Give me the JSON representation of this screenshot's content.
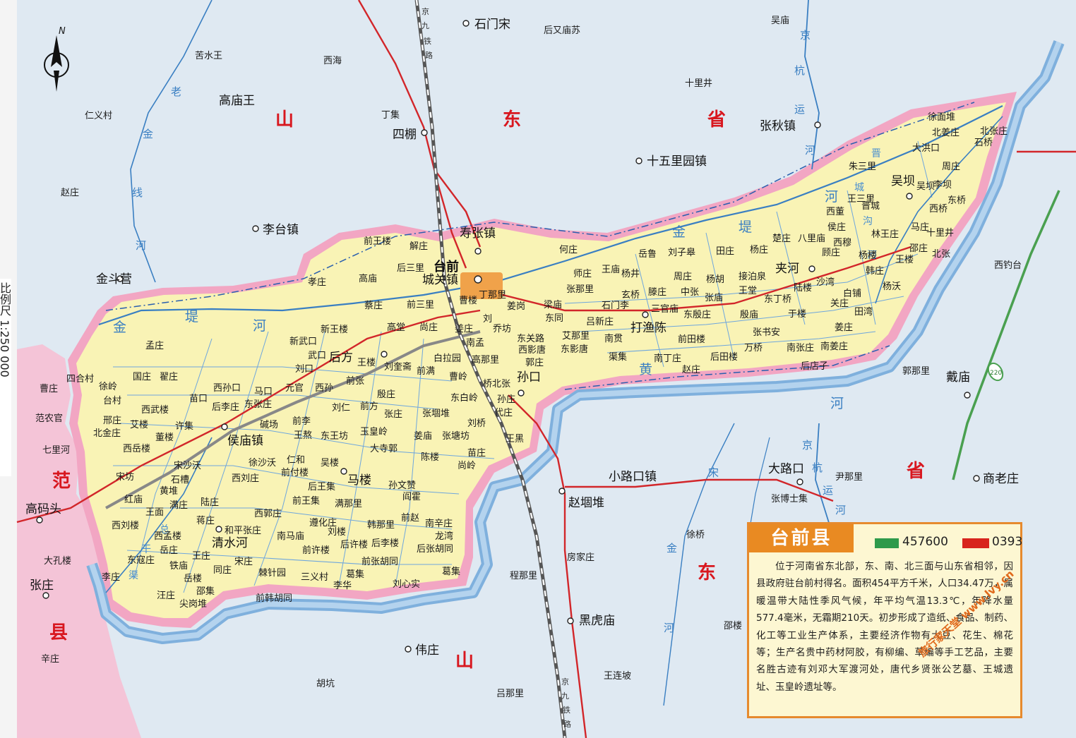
{
  "county": {
    "title": "台前县",
    "postal_code": "457600",
    "area_code": "0393",
    "description": "位于河南省东北部，东、南、北三面与山东省相邻，因县政府驻台前村得名。面积454平方千米，人口34.47万，属暖温带大陆性季风气候，年平均气温13.3℃，年降水量577.4毫米，无霜期210天。初步形成了造纸、食品、制药、化工等工业生产体系，主要经济作物有大豆、花生、棉花等；生产名贵中药材阿胶，有柳编、草编等手工艺品，主要名胜古迹有刘邓大军渡河处，唐代乡贤张公艺墓、王城遗址、玉皇岭遗址等。"
  },
  "compass": {
    "north": "N"
  },
  "side_label": "比例尺 1:250 000",
  "watermark": "旅行家天堂 www.lvy.cn",
  "colors": {
    "county_fill": "#f9f3b5",
    "border_pink": "#f2a6c3",
    "river": "#3a7fc2",
    "road_red": "#d2262a",
    "outside": "#dfe9f2"
  },
  "provinces": [
    {
      "id": "p1",
      "text": "山"
    },
    {
      "id": "p2",
      "text": "东"
    },
    {
      "id": "p3",
      "text": "省"
    },
    {
      "id": "p4",
      "text": "山"
    },
    {
      "id": "p5",
      "text": "东"
    },
    {
      "id": "p6",
      "text": "省"
    },
    {
      "id": "p7",
      "text": "范"
    },
    {
      "id": "p8",
      "text": "县"
    }
  ],
  "rivers": [
    {
      "id": "r1",
      "text": "黄"
    },
    {
      "id": "r2",
      "text": "河"
    },
    {
      "id": "r3",
      "text": "金"
    },
    {
      "id": "r4",
      "text": "堤"
    },
    {
      "id": "r5",
      "text": "河"
    },
    {
      "id": "r6",
      "text": "金"
    },
    {
      "id": "r7",
      "text": "堤"
    },
    {
      "id": "r8",
      "text": "河"
    },
    {
      "id": "r9",
      "text": "老"
    },
    {
      "id": "r10",
      "text": "金"
    },
    {
      "id": "r11",
      "text": "线"
    },
    {
      "id": "r12",
      "text": "河"
    },
    {
      "id": "r13",
      "text": "京"
    },
    {
      "id": "r14",
      "text": "杭"
    },
    {
      "id": "r15",
      "text": "运"
    },
    {
      "id": "r16",
      "text": "河"
    },
    {
      "id": "r17",
      "text": "京"
    },
    {
      "id": "r18",
      "text": "杭"
    },
    {
      "id": "r19",
      "text": "运"
    },
    {
      "id": "r20",
      "text": "河"
    },
    {
      "id": "r21",
      "text": "宋"
    },
    {
      "id": "r22",
      "text": "金"
    },
    {
      "id": "r23",
      "text": "河"
    },
    {
      "id": "r24",
      "text": "晋"
    },
    {
      "id": "r25",
      "text": "城"
    },
    {
      "id": "r26",
      "text": "沟"
    },
    {
      "id": "r27",
      "text": "河"
    },
    {
      "id": "r28",
      "text": "总"
    },
    {
      "id": "r29",
      "text": "干"
    },
    {
      "id": "r30",
      "text": "渠"
    }
  ],
  "railways": [
    {
      "id": "rw1",
      "text": "京"
    },
    {
      "id": "rw2",
      "text": "九"
    },
    {
      "id": "rw3",
      "text": "铁"
    },
    {
      "id": "rw4",
      "text": "路"
    },
    {
      "id": "rw5",
      "text": "京"
    },
    {
      "id": "rw6",
      "text": "九"
    },
    {
      "id": "rw7",
      "text": "铁"
    },
    {
      "id": "rw8",
      "text": "路"
    }
  ],
  "highway_shield": "220",
  "towns": [
    {
      "id": "t1",
      "text": "台前"
    },
    {
      "id": "t2",
      "text": "城关镇"
    },
    {
      "id": "t3",
      "text": "寿张镇"
    },
    {
      "id": "t4",
      "text": "打渔陈"
    },
    {
      "id": "t5",
      "text": "孙口"
    },
    {
      "id": "t6",
      "text": "后方"
    },
    {
      "id": "t7",
      "text": "侯庙镇"
    },
    {
      "id": "t8",
      "text": "马楼"
    },
    {
      "id": "t9",
      "text": "清水河"
    },
    {
      "id": "t10",
      "text": "夹河"
    },
    {
      "id": "t11",
      "text": "吴坝"
    }
  ],
  "external_towns": [
    {
      "id": "e1",
      "text": "石门宋"
    },
    {
      "id": "e2",
      "text": "高庙王"
    },
    {
      "id": "e3",
      "text": "四棚"
    },
    {
      "id": "e4",
      "text": "张秋镇"
    },
    {
      "id": "e5",
      "text": "十五里园镇"
    },
    {
      "id": "e6",
      "text": "李台镇"
    },
    {
      "id": "e7",
      "text": "金斗营"
    },
    {
      "id": "e8",
      "text": "小路口镇"
    },
    {
      "id": "e9",
      "text": "赵堌堆"
    },
    {
      "id": "e10",
      "text": "大路口"
    },
    {
      "id": "e11",
      "text": "黑虎庙"
    },
    {
      "id": "e12",
      "text": "伟庄"
    },
    {
      "id": "e13",
      "text": "高码头"
    },
    {
      "id": "e14",
      "text": "张庄"
    },
    {
      "id": "e15",
      "text": "戴庙"
    },
    {
      "id": "e16",
      "text": "商老庄"
    }
  ],
  "villages": [
    {
      "id": "v1",
      "text": "吴庙"
    },
    {
      "id": "v2",
      "text": "后又庙苏"
    },
    {
      "id": "v3",
      "text": "苦水王"
    },
    {
      "id": "v4",
      "text": "西海"
    },
    {
      "id": "v5",
      "text": "十里井"
    },
    {
      "id": "v6",
      "text": "丁集"
    },
    {
      "id": "v7",
      "text": "仁义村"
    },
    {
      "id": "v8",
      "text": "赵庄"
    },
    {
      "id": "v9",
      "text": "西钓台"
    },
    {
      "id": "v10",
      "text": "郭那里"
    },
    {
      "id": "v11",
      "text": "尹那里"
    },
    {
      "id": "v12",
      "text": "张博士集"
    },
    {
      "id": "v13",
      "text": "徐桥"
    },
    {
      "id": "v14",
      "text": "房家庄"
    },
    {
      "id": "v15",
      "text": "程那里"
    },
    {
      "id": "v16",
      "text": "邵楼"
    },
    {
      "id": "v17",
      "text": "王连坡"
    },
    {
      "id": "v18",
      "text": "吕那里"
    },
    {
      "id": "v19",
      "text": "胡坑"
    },
    {
      "id": "v20",
      "text": "辛庄"
    },
    {
      "id": "v21",
      "text": "大孔楼"
    },
    {
      "id": "v22",
      "text": "曹庄"
    },
    {
      "id": "v23",
      "text": "范农官"
    },
    {
      "id": "v24",
      "text": "七里河"
    },
    {
      "id": "v25",
      "text": "前王楼"
    },
    {
      "id": "v26",
      "text": "解庄"
    },
    {
      "id": "v27",
      "text": "后三里"
    },
    {
      "id": "v28",
      "text": "高庙"
    },
    {
      "id": "v29",
      "text": "孝庄"
    },
    {
      "id": "v30",
      "text": "蔡庄"
    },
    {
      "id": "v31",
      "text": "前三里"
    },
    {
      "id": "v32",
      "text": "高堂"
    },
    {
      "id": "v33",
      "text": "尚庄"
    },
    {
      "id": "v34",
      "text": "新王楼"
    },
    {
      "id": "v35",
      "text": "新武口"
    },
    {
      "id": "v36",
      "text": "武口"
    },
    {
      "id": "v37",
      "text": "刘口"
    },
    {
      "id": "v38",
      "text": "王楼"
    },
    {
      "id": "v39",
      "text": "刘奎斋"
    },
    {
      "id": "v40",
      "text": "前满"
    },
    {
      "id": "v41",
      "text": "白拉园"
    },
    {
      "id": "v42",
      "text": "高那里"
    },
    {
      "id": "v43",
      "text": "曹岭"
    },
    {
      "id": "v44",
      "text": "前张"
    },
    {
      "id": "v45",
      "text": "西孙口"
    },
    {
      "id": "v46",
      "text": "马口"
    },
    {
      "id": "v47",
      "text": "元官"
    },
    {
      "id": "v48",
      "text": "西孙"
    },
    {
      "id": "v49",
      "text": "殷庄"
    },
    {
      "id": "v50",
      "text": "东白岭"
    },
    {
      "id": "v51",
      "text": "桥北张"
    },
    {
      "id": "v52",
      "text": "苗口"
    },
    {
      "id": "v53",
      "text": "后李庄"
    },
    {
      "id": "v54",
      "text": "东张庄"
    },
    {
      "id": "v55",
      "text": "刘仁"
    },
    {
      "id": "v56",
      "text": "前方"
    },
    {
      "id": "v57",
      "text": "张庄"
    },
    {
      "id": "v58",
      "text": "张堌堆"
    },
    {
      "id": "v59",
      "text": "孙庄"
    },
    {
      "id": "v60",
      "text": "代庄"
    },
    {
      "id": "v61",
      "text": "碱场"
    },
    {
      "id": "v62",
      "text": "前李"
    },
    {
      "id": "v63",
      "text": "王熬"
    },
    {
      "id": "v64",
      "text": "东王坊"
    },
    {
      "id": "v65",
      "text": "玉皇岭"
    },
    {
      "id": "v66",
      "text": "姜庙"
    },
    {
      "id": "v67",
      "text": "刘桥"
    },
    {
      "id": "v68",
      "text": "张塘坊"
    },
    {
      "id": "v69",
      "text": "王黑"
    },
    {
      "id": "v70",
      "text": "大寺郭"
    },
    {
      "id": "v71",
      "text": "陈楼"
    },
    {
      "id": "v72",
      "text": "苗庄"
    },
    {
      "id": "v73",
      "text": "尚岭"
    },
    {
      "id": "v74",
      "text": "宋沙沃"
    },
    {
      "id": "v75",
      "text": "徐沙沃"
    },
    {
      "id": "v76",
      "text": "仁和"
    },
    {
      "id": "v77",
      "text": "前付楼"
    },
    {
      "id": "v78",
      "text": "吴楼"
    },
    {
      "id": "v79",
      "text": "后王集"
    },
    {
      "id": "v80",
      "text": "石槽"
    },
    {
      "id": "v81",
      "text": "黄堆"
    },
    {
      "id": "v82",
      "text": "西刘庄"
    },
    {
      "id": "v83",
      "text": "前王集"
    },
    {
      "id": "v84",
      "text": "满那里"
    },
    {
      "id": "v85",
      "text": "孙文赞"
    },
    {
      "id": "v86",
      "text": "阎霍"
    },
    {
      "id": "v87",
      "text": "红庙"
    },
    {
      "id": "v88",
      "text": "王面"
    },
    {
      "id": "v89",
      "text": "满庄"
    },
    {
      "id": "v90",
      "text": "陆庄"
    },
    {
      "id": "v91",
      "text": "西郭庄"
    },
    {
      "id": "v92",
      "text": "韩那里"
    },
    {
      "id": "v93",
      "text": "前赵"
    },
    {
      "id": "v94",
      "text": "西刘楼"
    },
    {
      "id": "v95",
      "text": "西孟楼"
    },
    {
      "id": "v96",
      "text": "蒋庄"
    },
    {
      "id": "v97",
      "text": "和平张庄"
    },
    {
      "id": "v98",
      "text": "南马庙"
    },
    {
      "id": "v99",
      "text": "遵化庄"
    },
    {
      "id": "v100",
      "text": "刘楼"
    },
    {
      "id": "v101",
      "text": "南辛庄"
    },
    {
      "id": "v102",
      "text": "龙湾"
    },
    {
      "id": "v103",
      "text": "后李楼"
    },
    {
      "id": "v104",
      "text": "后许楼"
    },
    {
      "id": "v105",
      "text": "前许楼"
    },
    {
      "id": "v106",
      "text": "后张胡同"
    },
    {
      "id": "v107",
      "text": "东寇庄"
    },
    {
      "id": "v108",
      "text": "岳庄"
    },
    {
      "id": "v109",
      "text": "王庄"
    },
    {
      "id": "v110",
      "text": "铁庙"
    },
    {
      "id": "v111",
      "text": "宋庄"
    },
    {
      "id": "v112",
      "text": "同庄"
    },
    {
      "id": "v113",
      "text": "棘针园"
    },
    {
      "id": "v114",
      "text": "前张胡同"
    },
    {
      "id": "v115",
      "text": "葛集"
    },
    {
      "id": "v116",
      "text": "李庄"
    },
    {
      "id": "v117",
      "text": "岳楼"
    },
    {
      "id": "v118",
      "text": "邵集"
    },
    {
      "id": "v119",
      "text": "三义村"
    },
    {
      "id": "v120",
      "text": "李华"
    },
    {
      "id": "v121",
      "text": "刘心实"
    },
    {
      "id": "v122",
      "text": "葛集"
    },
    {
      "id": "v123",
      "text": "汪庄"
    },
    {
      "id": "v124",
      "text": "尖岗堆"
    },
    {
      "id": "v125",
      "text": "前韩胡同"
    },
    {
      "id": "v126",
      "text": "四合村"
    },
    {
      "id": "v127",
      "text": "徐岭"
    },
    {
      "id": "v128",
      "text": "台村"
    },
    {
      "id": "v129",
      "text": "邢庄"
    },
    {
      "id": "v130",
      "text": "北金庄"
    },
    {
      "id": "v131",
      "text": "西武楼"
    },
    {
      "id": "v132",
      "text": "艾楼"
    },
    {
      "id": "v133",
      "text": "董楼"
    },
    {
      "id": "v134",
      "text": "西岳楼"
    },
    {
      "id": "v135",
      "text": "许集"
    },
    {
      "id": "v136",
      "text": "国庄"
    },
    {
      "id": "v137",
      "text": "翟庄"
    },
    {
      "id": "v138",
      "text": "孟庄"
    },
    {
      "id": "v139",
      "text": "宋坊"
    },
    {
      "id": "v140",
      "text": "何庄"
    },
    {
      "id": "v141",
      "text": "岳鲁"
    },
    {
      "id": "v142",
      "text": "刘子皋"
    },
    {
      "id": "v143",
      "text": "田庄"
    },
    {
      "id": "v144",
      "text": "杨庄"
    },
    {
      "id": "v145",
      "text": "楚庄"
    },
    {
      "id": "v146",
      "text": "八里庙"
    },
    {
      "id": "v147",
      "text": "顾庄"
    },
    {
      "id": "v148",
      "text": "王庙"
    },
    {
      "id": "v149",
      "text": "杨井"
    },
    {
      "id": "v150",
      "text": "师庄"
    },
    {
      "id": "v151",
      "text": "张那里"
    },
    {
      "id": "v152",
      "text": "周庄"
    },
    {
      "id": "v153",
      "text": "杨胡"
    },
    {
      "id": "v154",
      "text": "接泊泉"
    },
    {
      "id": "v155",
      "text": "陆楼"
    },
    {
      "id": "v156",
      "text": "沙湾"
    },
    {
      "id": "v157",
      "text": "玄桥"
    },
    {
      "id": "v158",
      "text": "滕庄"
    },
    {
      "id": "v159",
      "text": "中张"
    },
    {
      "id": "v160",
      "text": "张庙"
    },
    {
      "id": "v161",
      "text": "王堂"
    },
    {
      "id": "v162",
      "text": "东丁桥"
    },
    {
      "id": "v163",
      "text": "三官庙"
    },
    {
      "id": "v164",
      "text": "东殷庄"
    },
    {
      "id": "v165",
      "text": "殷庙"
    },
    {
      "id": "v166",
      "text": "于楼"
    },
    {
      "id": "v167",
      "text": "梁庙"
    },
    {
      "id": "v168",
      "text": "石门李"
    },
    {
      "id": "v169",
      "text": "吕新庄"
    },
    {
      "id": "v170",
      "text": "东同"
    },
    {
      "id": "v171",
      "text": "姜岗"
    },
    {
      "id": "v172",
      "text": "南贯"
    },
    {
      "id": "v173",
      "text": "前田楼"
    },
    {
      "id": "v174",
      "text": "后田楼"
    },
    {
      "id": "v175",
      "text": "张书安"
    },
    {
      "id": "v176",
      "text": "万桥"
    },
    {
      "id": "v177",
      "text": "南张庄"
    },
    {
      "id": "v178",
      "text": "南姜庄"
    },
    {
      "id": "v179",
      "text": "后店子"
    },
    {
      "id": "v180",
      "text": "艾那里"
    },
    {
      "id": "v181",
      "text": "东影唐"
    },
    {
      "id": "v182",
      "text": "西影唐"
    },
    {
      "id": "v183",
      "text": "东关路"
    },
    {
      "id": "v184",
      "text": "乔坊"
    },
    {
      "id": "v185",
      "text": "郭庄"
    },
    {
      "id": "v186",
      "text": "渠集"
    },
    {
      "id": "v187",
      "text": "南丁庄"
    },
    {
      "id": "v188",
      "text": "赵庄"
    },
    {
      "id": "v189",
      "text": "南孟"
    },
    {
      "id": "v190",
      "text": "曹楼"
    },
    {
      "id": "v191",
      "text": "丁那里"
    },
    {
      "id": "v192",
      "text": "刘"
    },
    {
      "id": "v193",
      "text": "姜庄"
    },
    {
      "id": "v194",
      "text": "徐面堆"
    },
    {
      "id": "v195",
      "text": "北姜庄"
    },
    {
      "id": "v196",
      "text": "北张庄"
    },
    {
      "id": "v197",
      "text": "大洪口"
    },
    {
      "id": "v198",
      "text": "石桥"
    },
    {
      "id": "v199",
      "text": "朱三里"
    },
    {
      "id": "v200",
      "text": "周庄"
    },
    {
      "id": "v201",
      "text": "王三里"
    },
    {
      "id": "v202",
      "text": "吴坝"
    },
    {
      "id": "v203",
      "text": "李坝"
    },
    {
      "id": "v204",
      "text": "西董"
    },
    {
      "id": "v205",
      "text": "晋城"
    },
    {
      "id": "v206",
      "text": "东桥"
    },
    {
      "id": "v207",
      "text": "西桥"
    },
    {
      "id": "v208",
      "text": "侯庄"
    },
    {
      "id": "v209",
      "text": "林王庄"
    },
    {
      "id": "v210",
      "text": "马庄"
    },
    {
      "id": "v211",
      "text": "十里井"
    },
    {
      "id": "v212",
      "text": "西穆"
    },
    {
      "id": "v213",
      "text": "邵庄"
    },
    {
      "id": "v214",
      "text": "北张"
    },
    {
      "id": "v215",
      "text": "杨楼"
    },
    {
      "id": "v216",
      "text": "王楼"
    },
    {
      "id": "v217",
      "text": "韩庄"
    },
    {
      "id": "v218",
      "text": "杨沃"
    },
    {
      "id": "v219",
      "text": "白铺"
    },
    {
      "id": "v220",
      "text": "关庄"
    },
    {
      "id": "v221",
      "text": "田湾"
    },
    {
      "id": "v222",
      "text": "姜庄"
    }
  ]
}
